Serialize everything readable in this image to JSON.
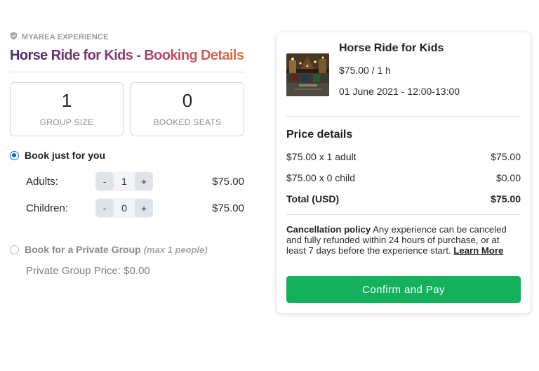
{
  "brand": {
    "name": "MYAREA EXPERIENCE",
    "icon": "shield-icon"
  },
  "page": {
    "title": "Horse Ride for Kids - Booking Details"
  },
  "stats": [
    {
      "value": "1",
      "label": "GROUP SIZE"
    },
    {
      "value": "0",
      "label": "BOOKED SEATS"
    }
  ],
  "booking_options": {
    "self": {
      "label": "Book just for you",
      "selected": true
    },
    "private": {
      "label": "Book for a Private Group",
      "note": "(max 1 people)",
      "selected": false,
      "price_label": "Private Group Price: $0.00"
    }
  },
  "quantities": [
    {
      "label": "Adults:",
      "minus": "-",
      "value": "1",
      "plus": "+",
      "price": "$75.00"
    },
    {
      "label": "Children:",
      "minus": "-",
      "value": "0",
      "plus": "+",
      "price": "$75.00"
    }
  ],
  "summary": {
    "title": "Horse Ride for Kids",
    "price": "$75.00 / 1 h",
    "date": "01 June 2021 - 12:00-13:00",
    "price_details_title": "Price details",
    "lines": [
      {
        "label": "$75.00 x 1 adult",
        "amount": "$75.00"
      },
      {
        "label": "$75.00 x 0 child",
        "amount": "$0.00"
      }
    ],
    "total": {
      "label": "Total (USD)",
      "amount": "$75.00"
    },
    "policy": {
      "heading": "Cancellation policy",
      "text": " Any experience can be canceled and fully refunded within 24 hours of purchase, or at least 7 days before the experience start. ",
      "link": "Learn More"
    },
    "confirm_label": "Confirm and Pay"
  },
  "colors": {
    "accent": "#1565d8",
    "confirm": "#15b05e"
  }
}
